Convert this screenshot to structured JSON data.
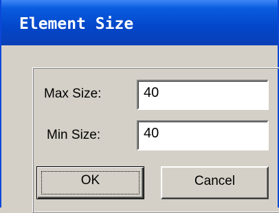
{
  "window": {
    "title": "Element Size"
  },
  "form": {
    "max_size_label": "Max Size:",
    "max_size_value": "40",
    "min_size_label": "Min Size:",
    "min_size_value": "40"
  },
  "buttons": {
    "ok_label": "OK",
    "cancel_label": "Cancel"
  },
  "colors": {
    "titlebar": "#0346c9",
    "face": "#d4d0c8"
  }
}
